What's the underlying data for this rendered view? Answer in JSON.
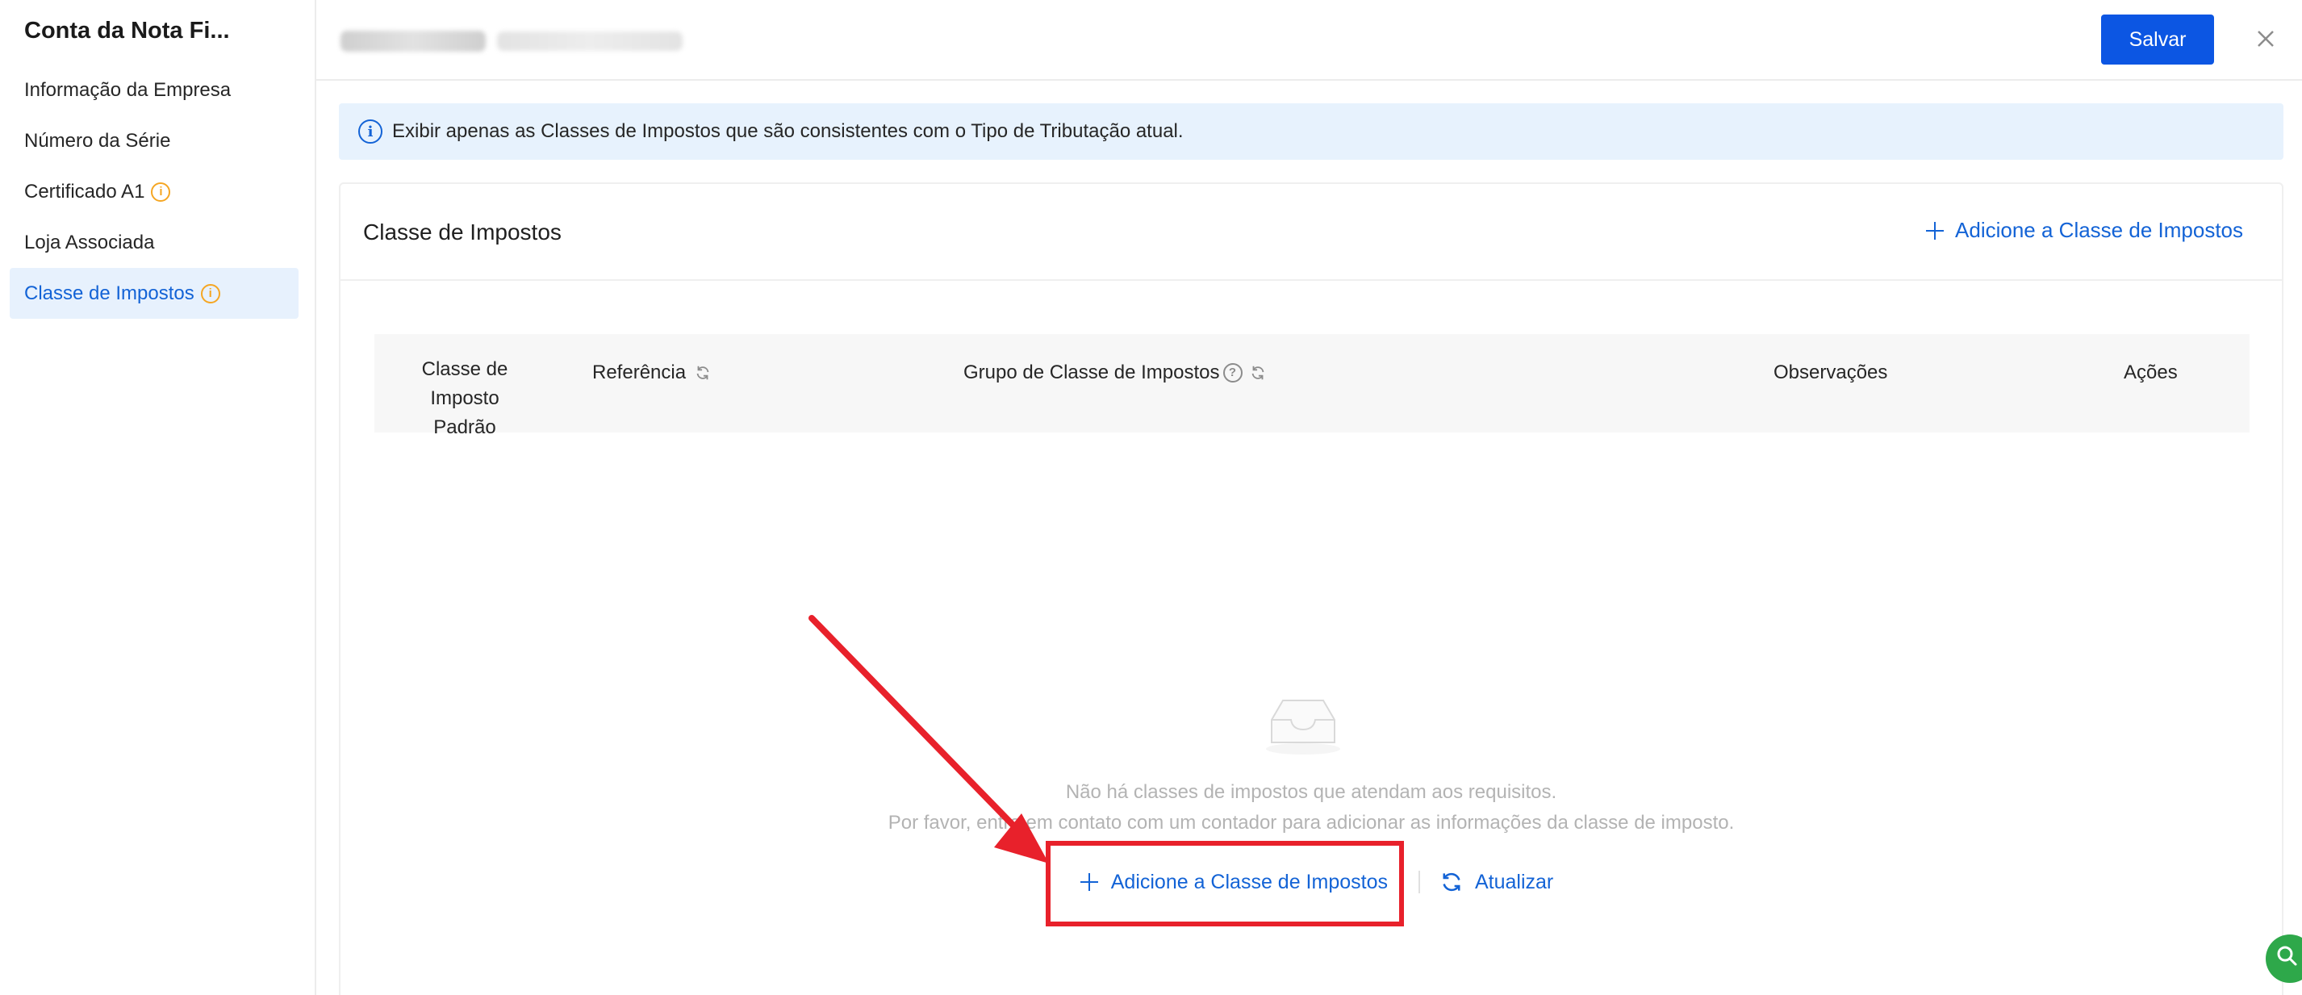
{
  "sidebar": {
    "title": "Conta da Nota Fi...",
    "items": [
      {
        "label": "Informação da Empresa"
      },
      {
        "label": "Número da Série"
      },
      {
        "label": "Certificado A1"
      },
      {
        "label": "Loja Associada"
      },
      {
        "label": "Classe de Impostos"
      }
    ]
  },
  "header": {
    "save_label": "Salvar"
  },
  "info_banner": {
    "text": "Exibir apenas as Classes de Impostos que são consistentes com o Tipo de Tributação atual."
  },
  "card": {
    "title": "Classe de Impostos",
    "add_label": "Adicione a Classe de Impostos"
  },
  "table": {
    "columns": {
      "default_line1": "Classe de Imposto",
      "default_line2": "Padrão",
      "reference": "Referência",
      "group": "Grupo de Classe de Impostos",
      "notes": "Observações",
      "actions": "Ações"
    }
  },
  "empty_state": {
    "line1": "Não há classes de impostos que atendam aos requisitos.",
    "line2": "Por favor, entre em contato com um contador para adicionar as informações da classe de imposto.",
    "add_label": "Adicione a Classe de Impostos",
    "refresh_label": "Atualizar"
  },
  "colors": {
    "accent": "#1363d6",
    "primary_button": "#0c56e3",
    "warning": "#f5a623",
    "annotation": "#e8212b"
  }
}
